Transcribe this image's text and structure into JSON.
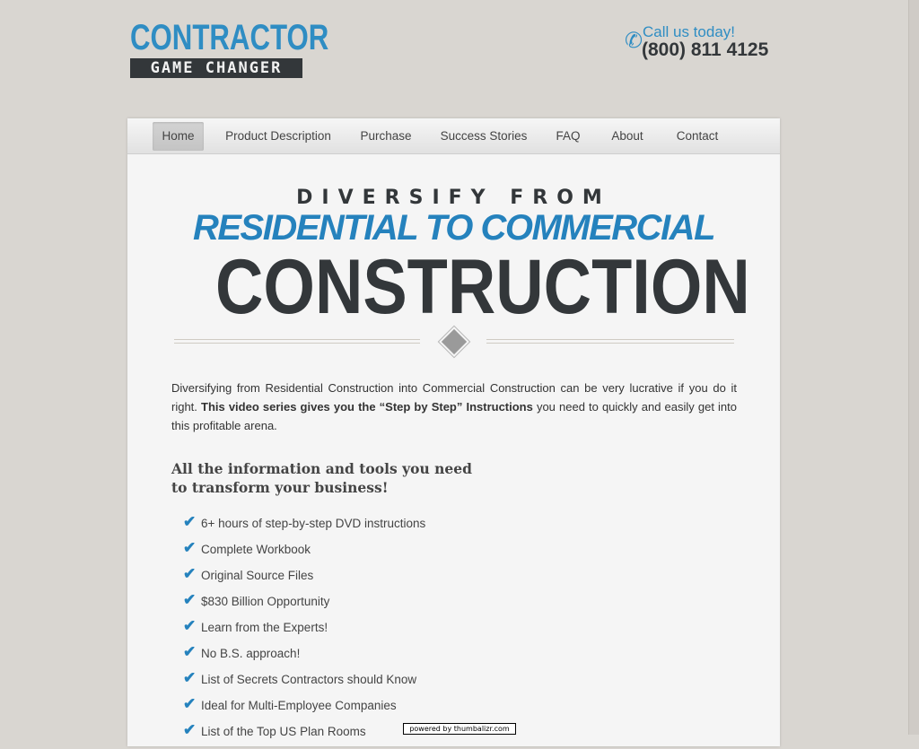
{
  "header": {
    "logo_top": "CONTRACTOR",
    "logo_bottom": "GAME CHANGER",
    "call_label": "Call us today!",
    "call_number": "(800) 811 4125",
    "phone_icon": "phone-icon"
  },
  "nav": {
    "items": [
      {
        "label": "Home",
        "active": true
      },
      {
        "label": "Product Description"
      },
      {
        "label": "Purchase"
      },
      {
        "label": "Success Stories"
      },
      {
        "label": "FAQ"
      },
      {
        "label": "About"
      },
      {
        "label": "Contact"
      }
    ]
  },
  "hero": {
    "line1": "DIVERSIFY FROM",
    "line2": "RESIDENTIAL TO COMMERCIAL",
    "line3": "CONSTRUCTION",
    "divider_icon": "badge-icon"
  },
  "intro": {
    "part1": "Diversifying from Residential Construction into Commercial Construction can be very lucrative if you do it right. ",
    "bold": "This video series gives you the “Step by Step” Instructions",
    "part2": " you need to quickly and easily get into this profitable arena."
  },
  "subhead": {
    "line1": "All the information and tools you need",
    "line2": "to transform your business!"
  },
  "features": [
    "6+ hours of step-by-step DVD instructions",
    "Complete Workbook",
    "Original Source Files",
    "$830 Billion Opportunity",
    "Learn from the Experts!",
    "No B.S. approach!",
    "List of Secrets  Contractors should Know",
    "Ideal for Multi-Employee Companies",
    "List of the Top US Plan Rooms"
  ],
  "footer": {
    "thumbalizr": "powered by thumbalizr.com"
  },
  "colors": {
    "accent": "#2582bd",
    "dark": "#33373a",
    "background": "#d9d6d1"
  }
}
